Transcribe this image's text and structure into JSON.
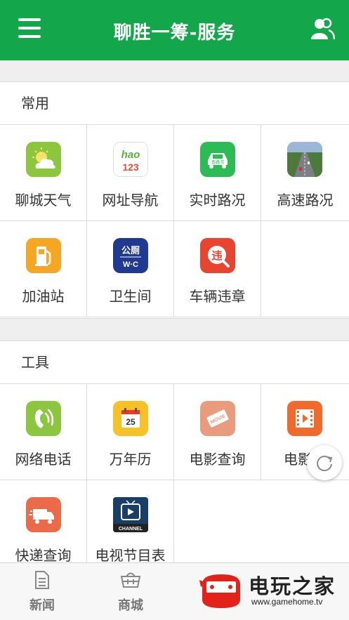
{
  "header": {
    "title": "聊胜一筹-服务"
  },
  "sections": [
    {
      "title": "常用",
      "items": [
        {
          "label": "聊城天气",
          "icon": "weather-icon"
        },
        {
          "label": "网址导航",
          "icon": "hao123-icon"
        },
        {
          "label": "实时路况",
          "icon": "traffic-icon"
        },
        {
          "label": "高速路况",
          "icon": "highway-icon"
        },
        {
          "label": "加油站",
          "icon": "gas-station-icon"
        },
        {
          "label": "卫生间",
          "icon": "toilet-icon"
        },
        {
          "label": "车辆违章",
          "icon": "violation-icon"
        }
      ]
    },
    {
      "title": "工具",
      "items": [
        {
          "label": "网络电话",
          "icon": "phone-icon"
        },
        {
          "label": "万年历",
          "icon": "calendar-icon"
        },
        {
          "label": "电影查询",
          "icon": "movie-ticket-icon"
        },
        {
          "label": "电影",
          "icon": "movie-play-icon"
        },
        {
          "label": "快递查询",
          "icon": "express-icon"
        },
        {
          "label": "电视节目表",
          "icon": "tv-channel-icon"
        }
      ]
    }
  ],
  "icon_text": {
    "hao": "hao",
    "n123": "123",
    "traffic": "查路况",
    "toilet_top": "公厕",
    "toilet_bottom": "W·C",
    "violation": "违",
    "movie": "MOVIE",
    "calendar_day": "25",
    "channel": "CHANNEL"
  },
  "bottom_nav": [
    {
      "label": "新闻",
      "icon": "news-icon"
    },
    {
      "label": "商城",
      "icon": "cart-icon"
    }
  ],
  "watermark": {
    "brand": "电玩之家",
    "url": "www.gamehome.tv"
  },
  "colors": {
    "primary": "#13a64a",
    "divider": "#dcdcdc"
  }
}
